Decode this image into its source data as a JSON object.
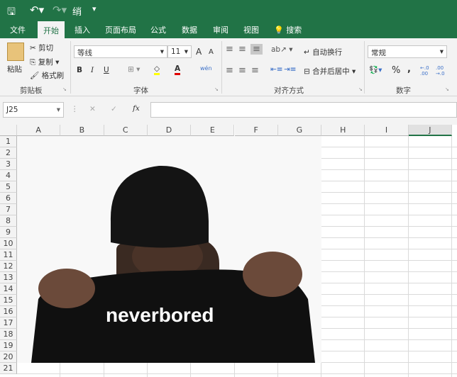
{
  "quick_access": {
    "save": "save-icon",
    "undo": "undo-icon",
    "redo": "redo-icon",
    "custom": "绡"
  },
  "tabs": [
    "文件",
    "开始",
    "插入",
    "页面布局",
    "公式",
    "数据",
    "审阅",
    "视图"
  ],
  "search_label": "搜索",
  "clipboard": {
    "paste": "粘贴",
    "cut": "剪切",
    "copy": "复制",
    "format_painter": "格式刷",
    "group": "剪贴板"
  },
  "font": {
    "name": "等线",
    "size": "11",
    "bold": "B",
    "italic": "I",
    "underline": "U",
    "grow": "A",
    "shrink": "A",
    "phonetic": "wén",
    "group": "字体",
    "font_color": "#e00000",
    "fill_color": "#ffff00"
  },
  "alignment": {
    "wrap": "自动换行",
    "merge": "合并后居中",
    "group": "对齐方式"
  },
  "number": {
    "format": "常规",
    "percent": "%",
    "comma": ",",
    "inc": "←.0 .00",
    "dec": ".00 →.0",
    "group": "数字"
  },
  "formula_bar": {
    "name_box": "J25",
    "fx": "fx",
    "value": ""
  },
  "columns": [
    "A",
    "B",
    "C",
    "D",
    "E",
    "F",
    "G",
    "H",
    "I",
    "J"
  ],
  "rows": [
    "1",
    "2",
    "3",
    "4",
    "5",
    "6",
    "7",
    "8",
    "9",
    "10",
    "11",
    "12",
    "13",
    "14",
    "15",
    "16",
    "17",
    "18",
    "19",
    "20",
    "21"
  ],
  "picture": {
    "shirt_text": "neverbored"
  },
  "colors": {
    "accent": "#217346",
    "ribbon": "#f3f3f3"
  }
}
